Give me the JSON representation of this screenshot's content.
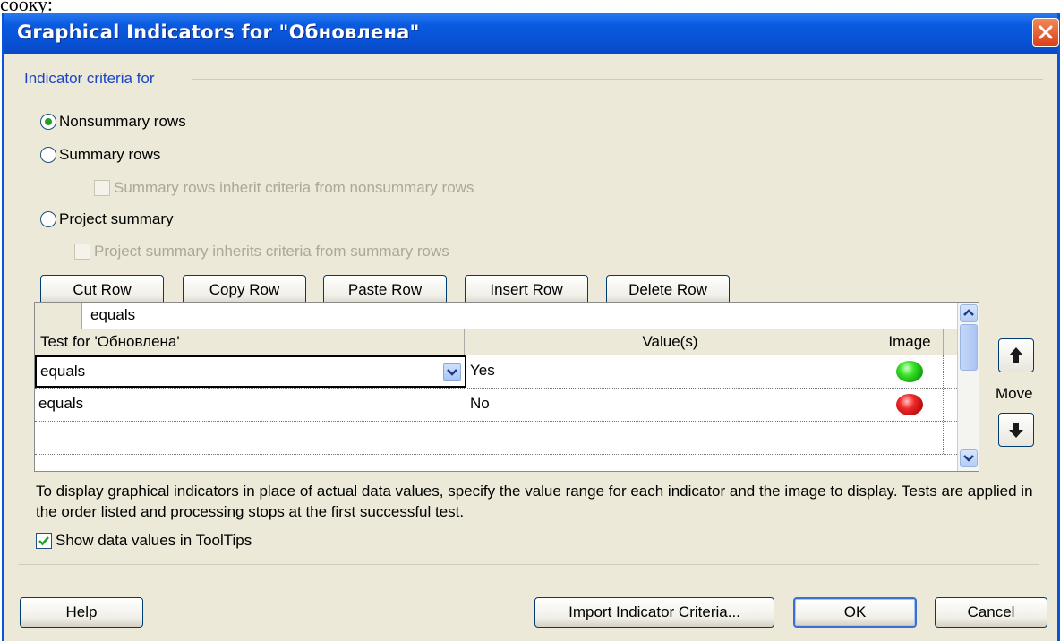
{
  "above_text": "сооку:",
  "window": {
    "title": "Graphical Indicators for \"Обновлена\""
  },
  "criteria": {
    "group_label": "Indicator criteria for",
    "nonsummary_label": "Nonsummary rows",
    "summary_label": "Summary rows",
    "summary_inherit_label": "Summary rows inherit criteria from nonsummary rows",
    "project_label": "Project summary",
    "project_inherit_label": "Project summary inherits criteria from summary rows",
    "selected": "Nonsummary rows"
  },
  "toolbar": {
    "cut": "Cut Row",
    "copy": "Copy Row",
    "paste": "Paste Row",
    "insert": "Insert Row",
    "delete": "Delete Row"
  },
  "grid": {
    "edit_value": "equals",
    "headers": {
      "test": "Test for 'Обновлена'",
      "values": "Value(s)",
      "image": "Image"
    },
    "rows": [
      {
        "test": "equals",
        "value": "Yes",
        "image": "green-circle",
        "color": "#1fc41f"
      },
      {
        "test": "equals",
        "value": "No",
        "image": "red-circle",
        "color": "#d81818"
      },
      {
        "test": "",
        "value": "",
        "image": ""
      }
    ]
  },
  "move_label": "Move",
  "description": "To display graphical indicators in place of actual data values, specify the value range for each indicator and the image to display.  Tests are applied in the order listed and processing stops at the first successful test.",
  "tooltips": {
    "label": "Show data values in ToolTips",
    "checked": true
  },
  "footer": {
    "help": "Help",
    "import": "Import Indicator Criteria...",
    "ok": "OK",
    "cancel": "Cancel"
  }
}
